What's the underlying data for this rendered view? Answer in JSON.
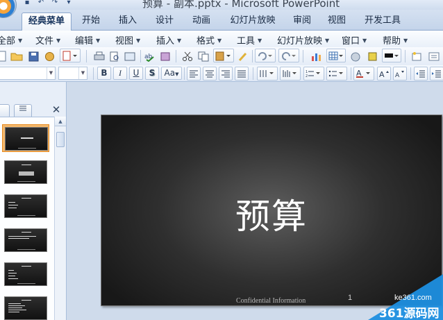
{
  "window": {
    "title": "预算 - 副本.pptx - Microsoft PowerPoint"
  },
  "quick_access": [
    {
      "icon": "save-icon",
      "glyph": "▪"
    },
    {
      "icon": "undo-icon",
      "glyph": "↶"
    },
    {
      "icon": "redo-icon",
      "glyph": "↷"
    },
    {
      "icon": "customize-icon",
      "glyph": "▾"
    }
  ],
  "ribbon_tabs": [
    {
      "label": "经典菜单",
      "active": true
    },
    {
      "label": "开始"
    },
    {
      "label": "插入"
    },
    {
      "label": "设计"
    },
    {
      "label": "动画"
    },
    {
      "label": "幻灯片放映"
    },
    {
      "label": "审阅"
    },
    {
      "label": "视图"
    },
    {
      "label": "开发工具"
    }
  ],
  "menu": [
    {
      "label": "全部"
    },
    {
      "label": "文件"
    },
    {
      "label": "编辑"
    },
    {
      "label": "视图"
    },
    {
      "label": "插入"
    },
    {
      "label": "格式"
    },
    {
      "label": "工具"
    },
    {
      "label": "幻灯片放映"
    },
    {
      "label": "窗口"
    },
    {
      "label": "帮助"
    }
  ],
  "format_buttons": [
    {
      "label": "B",
      "icon": "bold-icon"
    },
    {
      "label": "I",
      "icon": "italic-icon"
    },
    {
      "label": "U",
      "icon": "underline-icon"
    },
    {
      "label": "S",
      "icon": "shadow-icon"
    },
    {
      "label": "Aa",
      "icon": "change-case-icon"
    }
  ],
  "panel": {
    "close_glyph": "✕"
  },
  "slide": {
    "title": "预算",
    "footer": "Confidential Information",
    "number": "1"
  },
  "watermark": {
    "url": "ke361.com",
    "name": "361源码网"
  },
  "colors": {
    "accent": "#1e8fe0",
    "selection": "#f3b76b",
    "ribbon": "#c4d4ea"
  }
}
